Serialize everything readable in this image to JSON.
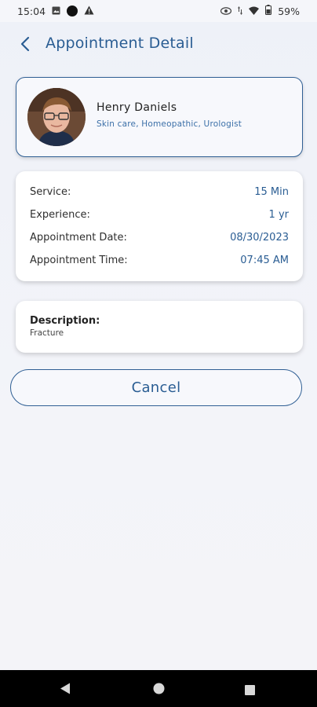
{
  "status_bar": {
    "time": "15:04",
    "battery": "59%"
  },
  "header": {
    "title": "Appointment Detail"
  },
  "doctor": {
    "name": "Henry Daniels",
    "specialties": "Skin care, Homeopathic, Urologist"
  },
  "details": [
    {
      "label": "Service:",
      "value": "15 Min"
    },
    {
      "label": "Experience:",
      "value": "1 yr"
    },
    {
      "label": "Appointment Date:",
      "value": "08/30/2023"
    },
    {
      "label": "Appointment Time:",
      "value": "07:45 AM"
    }
  ],
  "description": {
    "title": "Description:",
    "text": "Fracture"
  },
  "actions": {
    "cancel_label": "Cancel"
  },
  "colors": {
    "accent": "#2a5d93",
    "background": "#eef1f8"
  }
}
